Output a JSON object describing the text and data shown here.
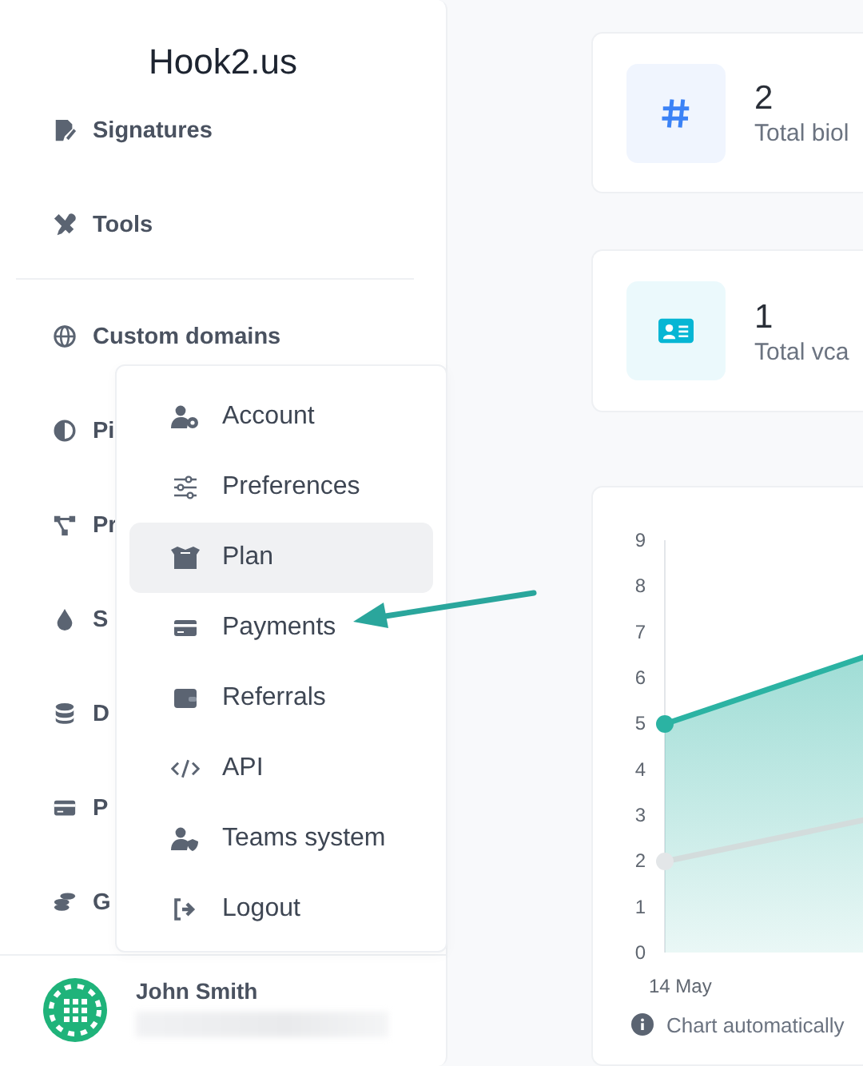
{
  "sidebar": {
    "logo": "Hook2.us",
    "items": [
      {
        "label": "Signatures"
      },
      {
        "label": "Tools"
      },
      {
        "label": "Custom domains"
      },
      {
        "label": "Pi"
      },
      {
        "label": "Pr"
      },
      {
        "label": "S"
      },
      {
        "label": "D"
      },
      {
        "label": "P"
      },
      {
        "label": "G"
      }
    ],
    "user": {
      "name": "John Smith"
    }
  },
  "user_menu": {
    "items": [
      {
        "label": "Account",
        "selected": false
      },
      {
        "label": "Preferences",
        "selected": false
      },
      {
        "label": "Plan",
        "selected": true
      },
      {
        "label": "Payments",
        "selected": false
      },
      {
        "label": "Referrals",
        "selected": false
      },
      {
        "label": "API",
        "selected": false
      },
      {
        "label": "Teams system",
        "selected": false
      },
      {
        "label": "Logout",
        "selected": false
      }
    ]
  },
  "stats": [
    {
      "value": "2",
      "label": "Total biol",
      "color": "#3b82f6"
    },
    {
      "value": "1",
      "label": "Total vca",
      "color": "#06b6d4"
    }
  ],
  "chart": {
    "y_axis_labels": [
      "9",
      "8",
      "7",
      "6",
      "5",
      "4",
      "3",
      "2",
      "1",
      "0"
    ],
    "x_axis_label": "14 May",
    "note": "Chart automatically"
  }
}
